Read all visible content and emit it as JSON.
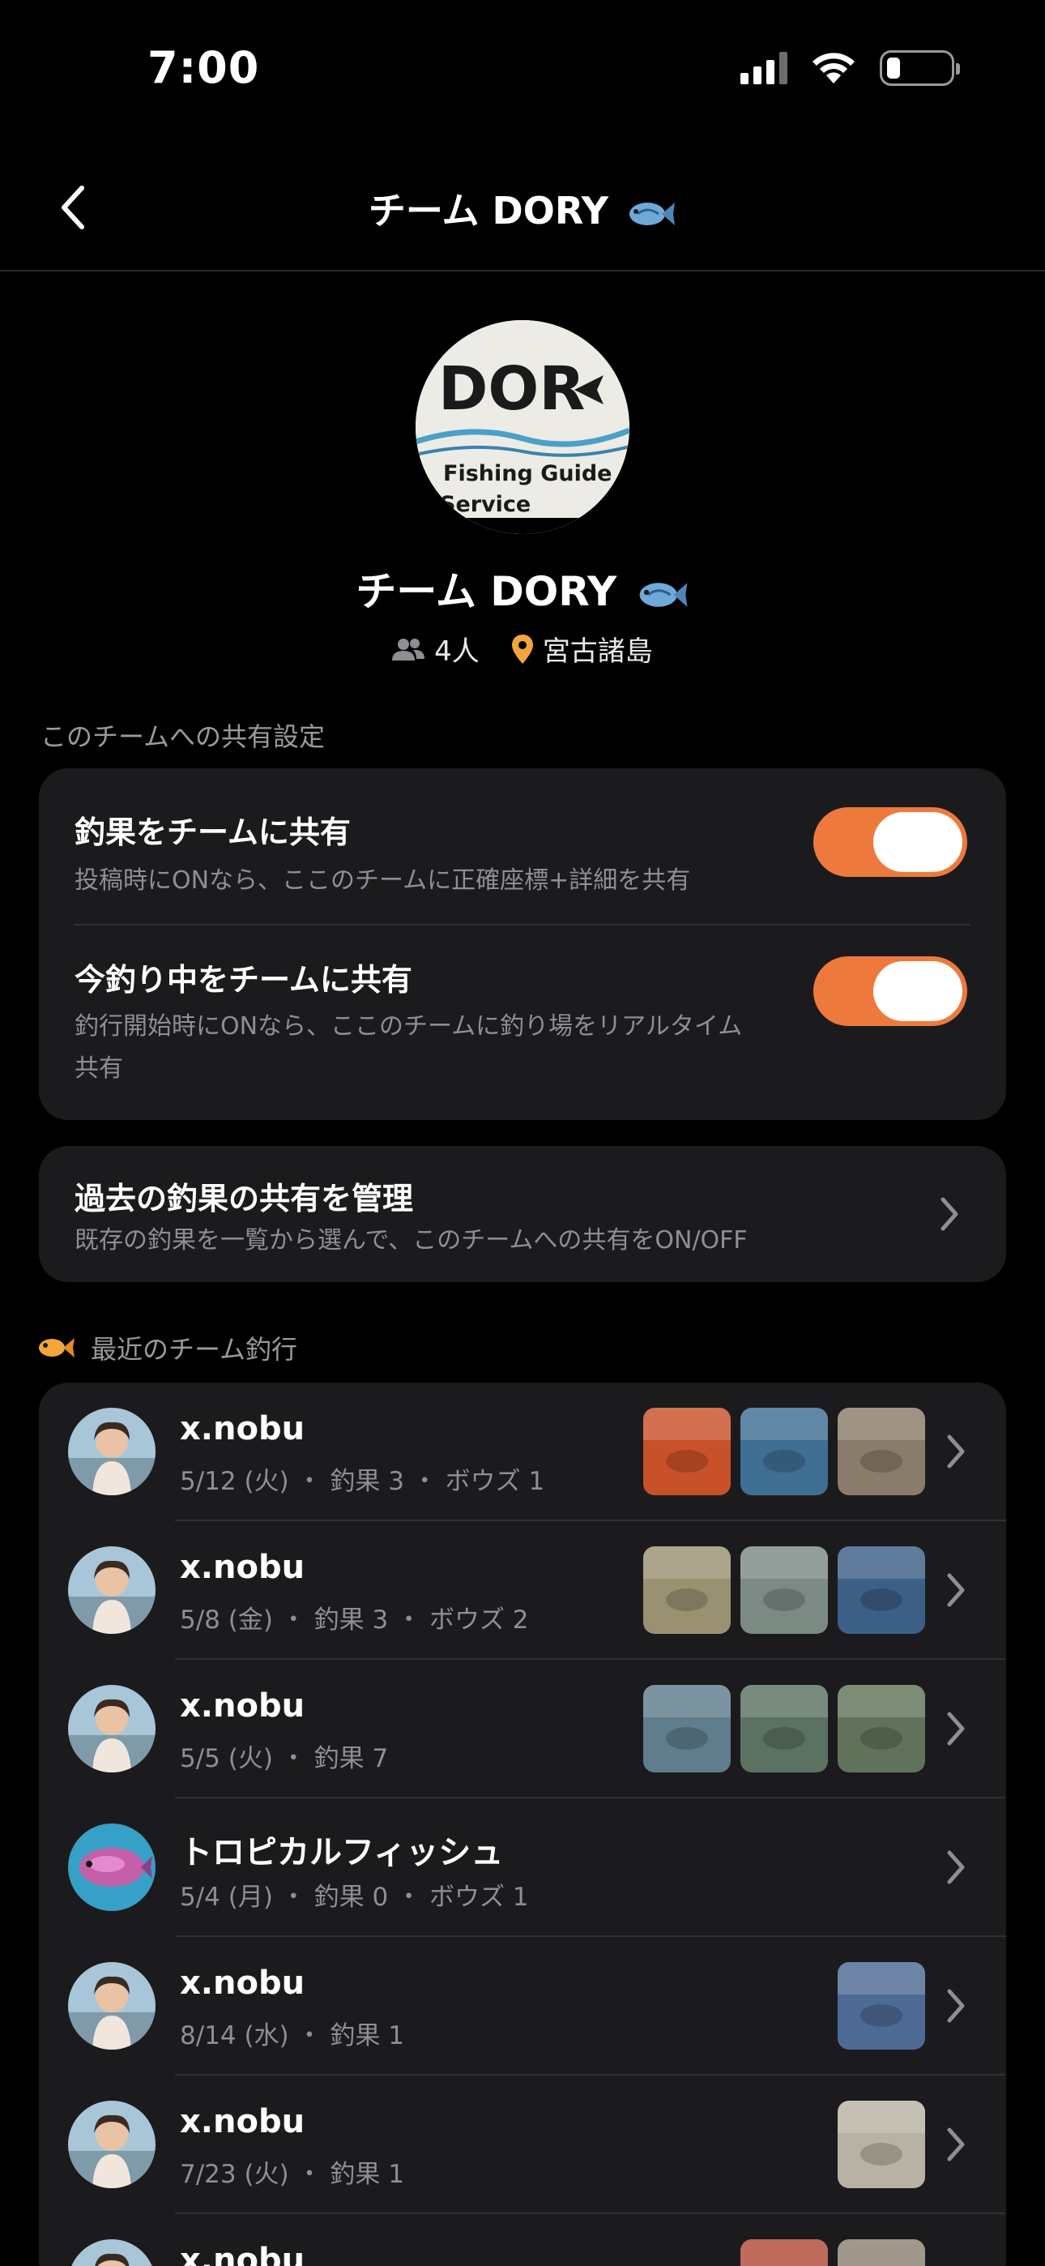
{
  "status_bar": {
    "time": "7:00"
  },
  "nav": {
    "title": "チーム DORY"
  },
  "team": {
    "name": "チーム DORY",
    "members": "4人",
    "location": "宮古諸島",
    "logo": {
      "text_main": "DOR",
      "text_line1": "Fishing Guide",
      "text_line2": "Service"
    }
  },
  "share_section": {
    "label": "このチームへの共有設定",
    "rows": [
      {
        "title": "釣果をチームに共有",
        "desc": "投稿時にONなら、ここのチームに正確座標+詳細を共有",
        "enabled": true
      },
      {
        "title": "今釣り中をチームに共有",
        "desc_line1": "釣行開始時にONなら、ここのチームに釣り場をリアルタイム",
        "desc_line2": "共有",
        "enabled": true
      }
    ]
  },
  "manage": {
    "title": "過去の釣果の共有を管理",
    "desc": "既存の釣果を一覧から選んで、このチームへの共有をON/OFF"
  },
  "recent": {
    "label": "最近のチーム釣行",
    "trips": [
      {
        "name": "x.nobu",
        "date": "5/12 (火)",
        "stats": "釣果 3 ・ ボウズ 1",
        "thumbs": [
          "#c8512a",
          "#3f6e93",
          "#8a7c6a"
        ]
      },
      {
        "name": "x.nobu",
        "date": "5/8 (金)",
        "stats": "釣果 3 ・ ボウズ 2",
        "thumbs": [
          "#9a9072",
          "#7c8a84",
          "#3c5f86"
        ]
      },
      {
        "name": "x.nobu",
        "date": "5/5 (火)",
        "stats": "釣果 7",
        "thumbs": [
          "#5f7d8c",
          "#5b7262",
          "#60735a"
        ]
      },
      {
        "name": "トロピカルフィッシュ",
        "date": "5/4 (月)",
        "stats": "釣果 0 ・ ボウズ 1",
        "thumbs": []
      },
      {
        "name": "x.nobu",
        "date": "8/14 (水)",
        "stats": "釣果 1",
        "thumbs": [
          "#4d6a94"
        ]
      },
      {
        "name": "x.nobu",
        "date": "7/23 (火)",
        "stats": "釣果 1",
        "thumbs": [
          "#b8b2a4"
        ]
      },
      {
        "name": "x.nobu",
        "date": "",
        "stats": "",
        "thumbs": [
          "#b04a3a",
          "#8a8272"
        ]
      }
    ]
  },
  "colors": {
    "accent": "#ed7a3c",
    "card_bg": "#1b1b1d",
    "location_pin": "#f2a53a"
  },
  "icons": [
    "back-chevron-icon",
    "fish-icon",
    "people-icon",
    "location-pin-icon",
    "chevron-right-icon"
  ]
}
